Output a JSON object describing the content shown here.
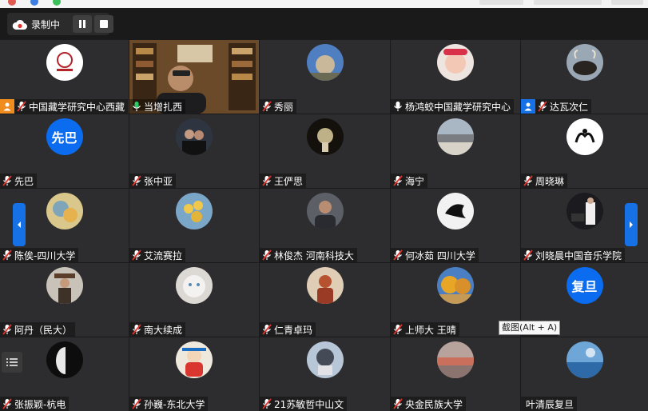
{
  "toolbar": {
    "recording_label": "录制中"
  },
  "tooltip": {
    "text": "截图(Alt + A)"
  },
  "tiles": [
    {
      "name": "中国藏学研究中心西藏",
      "avatar": "logo-seal",
      "role": "host"
    },
    {
      "name": "当增扎西",
      "avatar": "video-study",
      "mic": "on",
      "active": true
    },
    {
      "name": "秀丽",
      "avatar": "tree-photo"
    },
    {
      "name": "杨鸿蛟中国藏学研究中心",
      "avatar": "baby-photo",
      "mic": "plain"
    },
    {
      "name": "达瓦次仁",
      "avatar": "yak-photo",
      "role": "cohost"
    },
    {
      "name": "先巴",
      "avatar_text": "先巴"
    },
    {
      "name": "张中亚",
      "avatar": "couple-photo"
    },
    {
      "name": "王俨思",
      "avatar": "candle-photo"
    },
    {
      "name": "海宁",
      "avatar": "lake-photo"
    },
    {
      "name": "周晓琳",
      "avatar": "bird-logo"
    },
    {
      "name": "陈俟-四川大学",
      "avatar": "painting-photo"
    },
    {
      "name": "艾流赛拉",
      "avatar": "flower-photo"
    },
    {
      "name": "林俊杰 河南科技大",
      "avatar": "man-photo"
    },
    {
      "name": "何冰茹 四川大学",
      "avatar": "bird-ink"
    },
    {
      "name": "刘晓晨中国音乐学院",
      "avatar": "piano-photo"
    },
    {
      "name": "阿丹（民大）",
      "avatar": "cowboy-photo"
    },
    {
      "name": "南大续成",
      "avatar": "cat-photo"
    },
    {
      "name": "仁青卓玛",
      "avatar": "girl-art"
    },
    {
      "name": "上师大 王晴",
      "avatar": "autumn-photo"
    },
    {
      "name": "复旦",
      "avatar_text": "复旦"
    },
    {
      "name": "张振颖-杭电",
      "avatar": "mask-photo"
    },
    {
      "name": "孙巍-东北大学",
      "avatar": "cartoon-photo"
    },
    {
      "name": "21苏敏哲中山文",
      "avatar": "cat-cartoon"
    },
    {
      "name": "央金民族大学",
      "avatar": "sunset-photo"
    },
    {
      "name": "叶清辰复旦",
      "avatar": "sea-photo",
      "mic": "none"
    }
  ]
}
